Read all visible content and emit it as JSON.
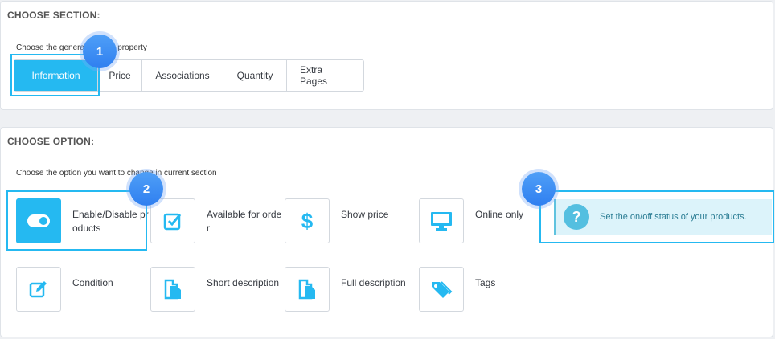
{
  "section": {
    "title": "CHOOSE SECTION:",
    "hint": "Choose the general product property",
    "tabs": [
      {
        "label": "Information",
        "active": true
      },
      {
        "label": "Price"
      },
      {
        "label": "Associations"
      },
      {
        "label": "Quantity"
      },
      {
        "label": "Extra Pages"
      }
    ]
  },
  "option": {
    "title": "CHOOSE OPTION:",
    "hint": "Choose the option you want to change in current section",
    "items": [
      {
        "label": "Enable/Disable products",
        "icon": "toggle-icon",
        "active": true
      },
      {
        "label": "Available for order",
        "icon": "checkbox-icon"
      },
      {
        "label": "Show price",
        "icon": "dollar-icon"
      },
      {
        "label": "Online only",
        "icon": "monitor-icon"
      },
      {
        "label": "Condition",
        "icon": "edit-icon"
      },
      {
        "label": "Short description",
        "icon": "document-icon"
      },
      {
        "label": "Full description",
        "icon": "document-icon"
      },
      {
        "label": "Tags",
        "icon": "tags-icon"
      }
    ]
  },
  "info": {
    "text": "Set the on/off status of your products.",
    "icon": "question-icon"
  },
  "badges": [
    "1",
    "2",
    "3"
  ],
  "colors": {
    "accent": "#25b9f1",
    "badge": "#3a8cf3",
    "info_bg": "#dcf3fa"
  }
}
